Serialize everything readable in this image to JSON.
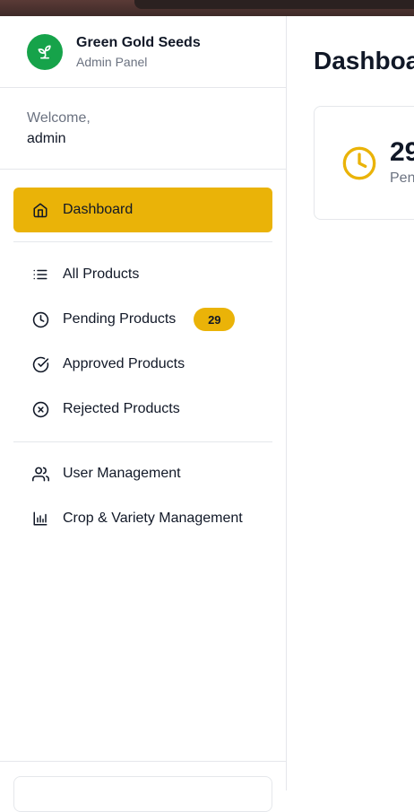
{
  "brand": {
    "title": "Green Gold Seeds",
    "subtitle": "Admin Panel",
    "logo_icon": "sprout-icon"
  },
  "welcome": {
    "label": "Welcome,",
    "user": "admin"
  },
  "nav": {
    "dashboard": {
      "label": "Dashboard",
      "icon": "home-icon"
    },
    "all_products": {
      "label": "All Products",
      "icon": "list-icon"
    },
    "pending_products": {
      "label": "Pending Products",
      "icon": "clock-icon",
      "badge": "29"
    },
    "approved_products": {
      "label": "Approved Products",
      "icon": "check-circle-icon"
    },
    "rejected_products": {
      "label": "Rejected Products",
      "icon": "x-circle-icon"
    },
    "user_management": {
      "label": "User Management",
      "icon": "users-icon"
    },
    "crop_variety": {
      "label": "Crop & Variety Management",
      "icon": "bar-chart-icon"
    }
  },
  "main": {
    "title": "Dashboard",
    "stat": {
      "value": "29",
      "label": "Pending Products",
      "icon": "clock-icon"
    }
  },
  "colors": {
    "accent": "#eab308",
    "brand_green": "#16a34a",
    "muted_text": "#6b7280",
    "border": "#e5e7eb"
  }
}
